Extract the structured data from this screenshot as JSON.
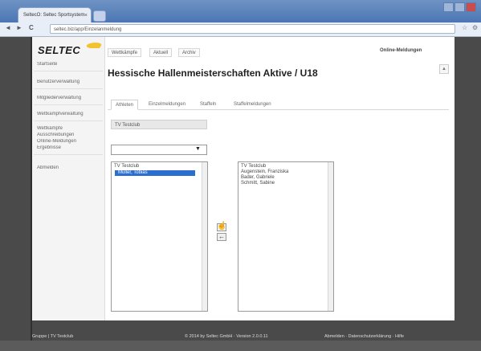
{
  "browser": {
    "tab_title": "SeltecO: Seltec Sportsystem",
    "tab_close": "×",
    "url": "seltec.biz/app/Einzelanmeldung",
    "back": "◄",
    "forward": "►",
    "reload": "C",
    "star": "☆",
    "wrench": "⚙"
  },
  "logo": {
    "text": "SELTEC"
  },
  "sidebar": {
    "items": [
      {
        "label": "Startseite"
      },
      {
        "label": "Benutzerverwaltung"
      },
      {
        "label": "Mitgliederverwaltung"
      },
      {
        "label": "Wettkampfverwaltung"
      },
      {
        "label": "Wettkämpfe"
      },
      {
        "label": "Abmelden"
      }
    ],
    "sub_items": [
      {
        "label": "Ausschreibungen"
      },
      {
        "label": "Online-Meldungen"
      },
      {
        "label": "Ergebnisse"
      }
    ]
  },
  "topnav": {
    "items": [
      {
        "label": "Wettkämpfe"
      },
      {
        "label": "Aktuell"
      },
      {
        "label": "Archiv"
      }
    ],
    "right_label": "Online-Meldungen"
  },
  "page": {
    "title": "Hessische Hallenmeisterschaften Aktive / U18",
    "scroll_button": "▲"
  },
  "tabs": [
    {
      "label": "Athleten",
      "active": true
    },
    {
      "label": "Einzelmeldungen",
      "active": false
    },
    {
      "label": "Staffeln",
      "active": false
    },
    {
      "label": "Staffelmeldungen",
      "active": false
    }
  ],
  "club": {
    "value": "TV Testclub"
  },
  "select": {
    "value": "",
    "arrow": "▼"
  },
  "left_list": {
    "group": "TV Testclub",
    "selected": "Müller, Tobias",
    "items": []
  },
  "right_list": {
    "group": "TV Testclub",
    "items": [
      "Augenstein, Franziska",
      "Bader, Gabriele",
      "Schmitt, Sabine"
    ]
  },
  "buttons": {
    "move_right": "→",
    "move_left": "←",
    "cursor": "☝"
  },
  "footer": {
    "left": "Gruppe | TV Testclub",
    "middle": "© 2014 by Seltec GmbH · Version 2.0.0.11",
    "right": "Abmelden · Datenschutzerklärung · Hilfe"
  },
  "colors": {
    "frame": "#4a4a4a",
    "selection": "#2a6fd0",
    "chrome": "#4b77b3",
    "logo_accent": "#f2c230"
  }
}
